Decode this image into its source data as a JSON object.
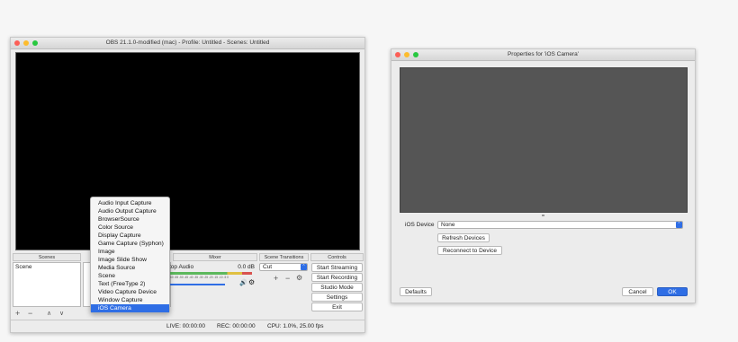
{
  "obs_window": {
    "title": "OBS 21.1.0-modified (mac) - Profile: Untitled - Scenes: Untitled"
  },
  "scenes": {
    "header": "Scenes",
    "items": [
      "Scene"
    ],
    "buttons": {
      "add": "+",
      "remove": "−",
      "up": "∧",
      "down": "∨"
    }
  },
  "mixer": {
    "header": "Mixer",
    "source_name": "top Audio",
    "level": "0.0 dB",
    "ticks": "-60 -55 -50 -45 -40 -35 -30 -25 -20 -15 -10 -5 0"
  },
  "transitions": {
    "header": "Scene Transitions",
    "selected": "Cut",
    "buttons": {
      "add": "+",
      "remove": "−"
    }
  },
  "controls": {
    "header": "Controls",
    "buttons": [
      "Start Streaming",
      "Start Recording",
      "Studio Mode",
      "Settings",
      "Exit"
    ]
  },
  "status_bar": {
    "live": "LIVE: 00:00:00",
    "rec": "REC: 00:00:00",
    "cpu": "CPU: 1.0%, 25.00 fps"
  },
  "add_source_menu": {
    "items": [
      "Audio Input Capture",
      "Audio Output Capture",
      "BrowserSource",
      "Color Source",
      "Display Capture",
      "Game Capture (Syphon)",
      "Image",
      "Image Slide Show",
      "Media Source",
      "Scene",
      "Text (FreeType 2)",
      "Video Capture Device",
      "Window Capture",
      "iOS Camera"
    ],
    "selected_index": 13
  },
  "properties_window": {
    "title": "Properties for 'iOS Camera'",
    "device_label": "iOS Device",
    "device_value": "None",
    "refresh_button": "Refresh Devices",
    "reconnect_button": "Reconnect to Device",
    "defaults_button": "Defaults",
    "cancel_button": "Cancel",
    "ok_button": "OK"
  },
  "colors": {
    "accent": "#2f6ee5",
    "close": "#fc5f57",
    "minimize": "#fdbc2e",
    "zoom": "#28c840",
    "preview_bg": "#000000",
    "properties_preview_bg": "#555555"
  }
}
